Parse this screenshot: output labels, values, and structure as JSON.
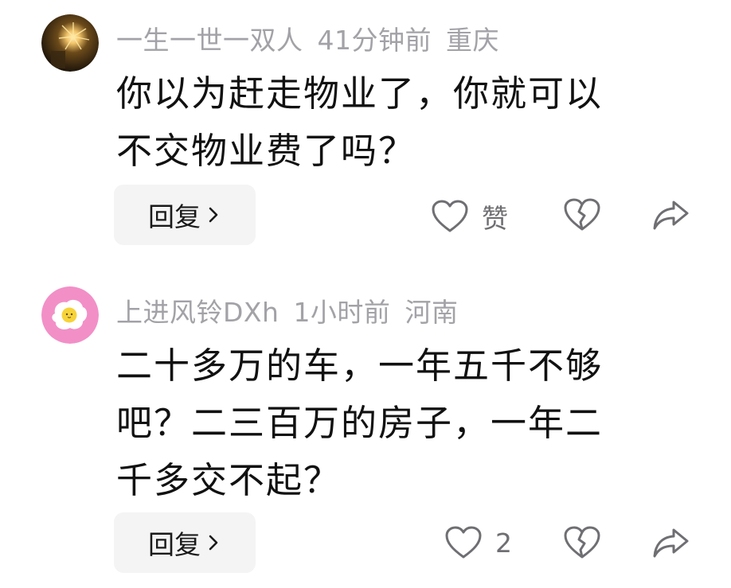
{
  "comments": [
    {
      "username": "一生一世一双人",
      "time": "41分钟前",
      "location": "重庆",
      "text_lines": [
        "你以为赶走物业了，你就可以",
        "不交物业费了吗？"
      ],
      "reply_label": "回复",
      "like_label": "赞",
      "avatar_icon": "firework-avatar",
      "avatar_colors": [
        "#2a1c0c",
        "#6b4a1a",
        "#f2c46a"
      ]
    },
    {
      "username": "上进风铃DXh",
      "time": "1小时前",
      "location": "河南",
      "text_lines": [
        "二十多万的车，一年五千不够",
        "吧？二三百万的房子，一年二",
        "千多交不起？"
      ],
      "reply_label": "回复",
      "like_label": "2",
      "avatar_icon": "fried-egg-avatar",
      "avatar_colors": [
        "#f28fc7",
        "#ffffff",
        "#f7d33a"
      ]
    }
  ],
  "icons": {
    "like": "heart-outline-icon",
    "dislike": "broken-heart-icon",
    "share": "share-arrow-icon",
    "chevron": "chevron-right-icon"
  },
  "colors": {
    "meta_text": "#a2a2a7",
    "body_text": "#111111",
    "icon_stroke": "#6f6f73",
    "reply_bg": "#f4f4f5"
  }
}
